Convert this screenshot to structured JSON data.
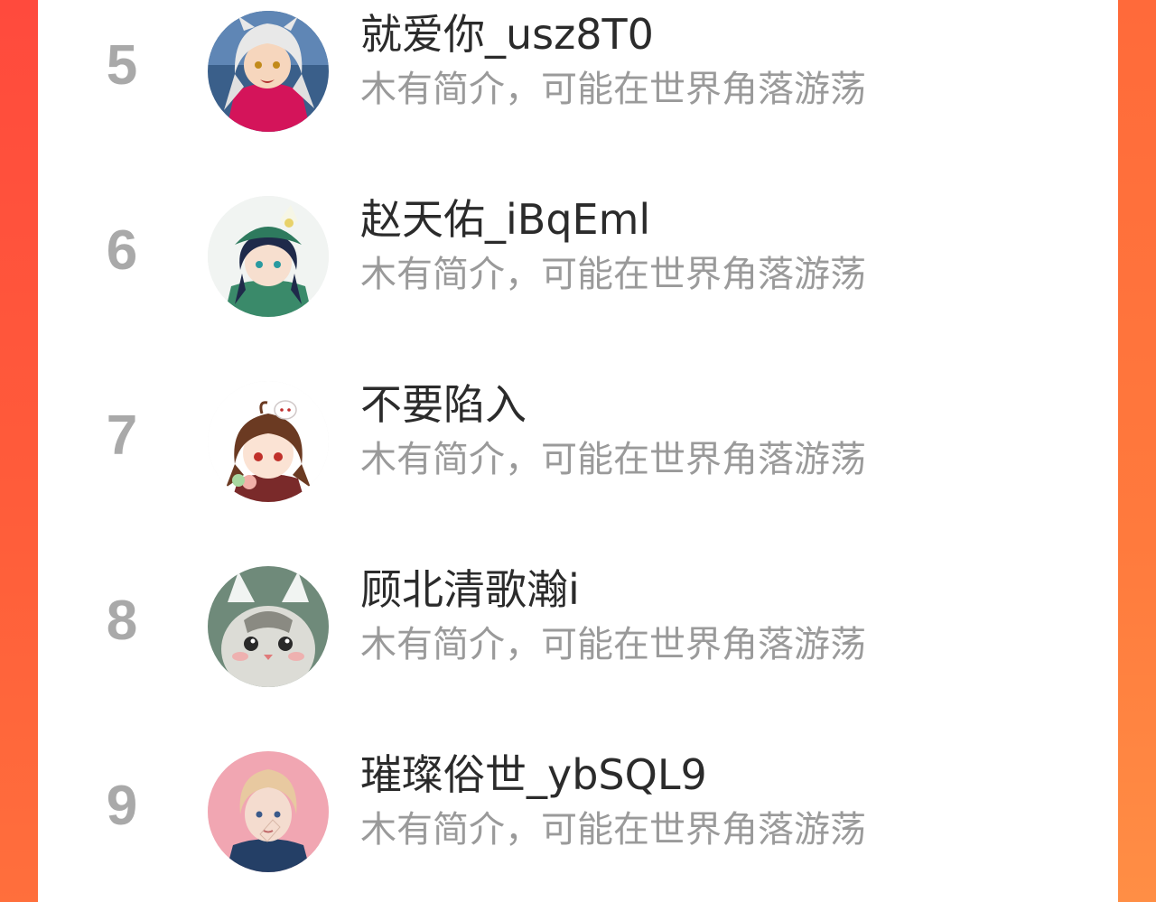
{
  "colors": {
    "background_left": "#ff4a3d",
    "background_right": "#ff7a3d",
    "card": "#ffffff",
    "rank_text": "#a9a9a9",
    "name_text": "#2b2b2b",
    "bio_text": "#9a9a9a"
  },
  "list": {
    "items": [
      {
        "rank": "5",
        "name": "就爱你_usz8T0",
        "bio": "木有简介，可能在世界角落游荡",
        "avatar_icon": "anime-white-hair-avatar"
      },
      {
        "rank": "6",
        "name": "赵天佑_iBqEml",
        "bio": "木有简介，可能在世界角落游荡",
        "avatar_icon": "anime-green-hat-avatar"
      },
      {
        "rank": "7",
        "name": "不要陷入",
        "bio": "木有简介，可能在世界角落游荡",
        "avatar_icon": "anime-brown-hair-girl-avatar"
      },
      {
        "rank": "8",
        "name": "顾北清歌瀚i",
        "bio": "木有简介，可能在世界角落游荡",
        "avatar_icon": "cat-avatar"
      },
      {
        "rank": "9",
        "name": "璀璨俗世_ybSQL9",
        "bio": "木有简介，可能在世界角落游荡",
        "avatar_icon": "illustrated-person-avatar"
      }
    ]
  }
}
